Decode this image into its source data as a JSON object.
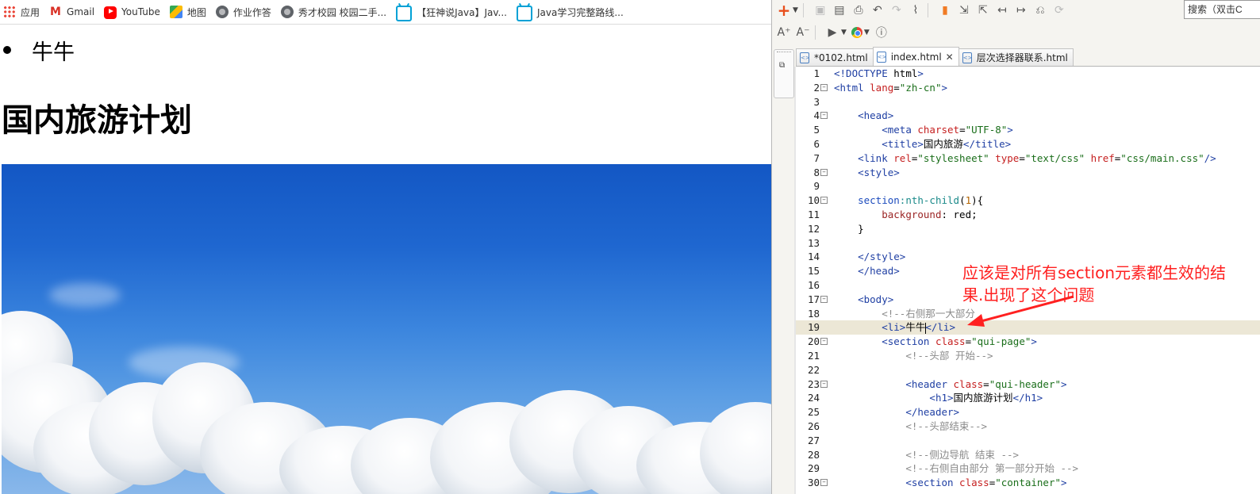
{
  "browser": {
    "bookmarks": [
      {
        "icon": "apps-icon",
        "label": "应用"
      },
      {
        "icon": "gmail-icon",
        "label": "Gmail"
      },
      {
        "icon": "youtube-icon",
        "label": "YouTube"
      },
      {
        "icon": "maps-icon",
        "label": "地图"
      },
      {
        "icon": "globe-icon",
        "label": "作业作答"
      },
      {
        "icon": "globe-icon",
        "label": "秀才校园 校园二手..."
      },
      {
        "icon": "bilibili-icon",
        "label": "【狂神说Java】Jav..."
      },
      {
        "icon": "bilibili-icon",
        "label": "Java学习完整路线..."
      }
    ],
    "page": {
      "list_item": "牛牛",
      "heading": "国内旅游计划",
      "hero_image": "sky-with-clouds"
    }
  },
  "editor": {
    "search_placeholder": "搜索（双击C",
    "tabs": [
      {
        "label": "*0102.html",
        "active": false,
        "closable": false
      },
      {
        "label": "index.html",
        "active": true,
        "closable": true
      },
      {
        "label": "层次选择器联系.html",
        "active": false,
        "closable": false
      }
    ],
    "current_line": 19,
    "lines": [
      {
        "n": "1",
        "fold": false,
        "tokens": [
          [
            "tg",
            "<!DOCTYPE "
          ],
          [
            "tx2",
            "html"
          ],
          [
            "tg",
            ">"
          ]
        ]
      },
      {
        "n": "2",
        "fold": true,
        "tokens": [
          [
            "tg",
            "<html "
          ],
          [
            "at",
            "lang"
          ],
          [
            "tx2",
            "="
          ],
          [
            "st",
            "\"zh-cn\""
          ],
          [
            "tg",
            ">"
          ]
        ]
      },
      {
        "n": "3",
        "fold": false,
        "tokens": []
      },
      {
        "n": "4",
        "fold": true,
        "tokens": [
          [
            "tx2",
            "    "
          ],
          [
            "tg",
            "<head>"
          ]
        ]
      },
      {
        "n": "5",
        "fold": false,
        "tokens": [
          [
            "tx2",
            "        "
          ],
          [
            "tg",
            "<meta "
          ],
          [
            "at",
            "charset"
          ],
          [
            "tx2",
            "="
          ],
          [
            "st",
            "\"UTF-8\""
          ],
          [
            "tg",
            ">"
          ]
        ]
      },
      {
        "n": "6",
        "fold": false,
        "tokens": [
          [
            "tx2",
            "        "
          ],
          [
            "tg",
            "<title>"
          ],
          [
            "tx2",
            "国内旅游"
          ],
          [
            "tg",
            "</title>"
          ]
        ]
      },
      {
        "n": "7",
        "fold": false,
        "tokens": [
          [
            "tx2",
            "    "
          ],
          [
            "tg",
            "<link "
          ],
          [
            "at",
            "rel"
          ],
          [
            "tx2",
            "="
          ],
          [
            "st",
            "\"stylesheet\" "
          ],
          [
            "at",
            "type"
          ],
          [
            "tx2",
            "="
          ],
          [
            "st",
            "\"text/css\" "
          ],
          [
            "at",
            "href"
          ],
          [
            "tx2",
            "="
          ],
          [
            "st",
            "\"css/main.css\""
          ],
          [
            "tg",
            "/>"
          ]
        ]
      },
      {
        "n": "8",
        "fold": true,
        "tokens": [
          [
            "tx2",
            "    "
          ],
          [
            "tg",
            "<style>"
          ]
        ]
      },
      {
        "n": "9",
        "fold": false,
        "tokens": []
      },
      {
        "n": "10",
        "fold": true,
        "tokens": [
          [
            "tx2",
            "    "
          ],
          [
            "sel",
            "section"
          ],
          [
            "ps",
            ":nth-child"
          ],
          [
            "tx2",
            "("
          ],
          [
            "nm",
            "1"
          ],
          [
            "tx2",
            "){"
          ]
        ]
      },
      {
        "n": "11",
        "fold": false,
        "tokens": [
          [
            "tx2",
            "        "
          ],
          [
            "pr",
            "background"
          ],
          [
            "tx2",
            ": red;"
          ]
        ]
      },
      {
        "n": "12",
        "fold": false,
        "tokens": [
          [
            "tx2",
            "    }"
          ]
        ]
      },
      {
        "n": "13",
        "fold": false,
        "tokens": []
      },
      {
        "n": "14",
        "fold": false,
        "tokens": [
          [
            "tx2",
            "    "
          ],
          [
            "tg",
            "</style>"
          ]
        ]
      },
      {
        "n": "15",
        "fold": false,
        "tokens": [
          [
            "tx2",
            "    "
          ],
          [
            "tg",
            "</head>"
          ]
        ]
      },
      {
        "n": "16",
        "fold": false,
        "tokens": []
      },
      {
        "n": "17",
        "fold": true,
        "tokens": [
          [
            "tx2",
            "    "
          ],
          [
            "tg",
            "<body>"
          ]
        ]
      },
      {
        "n": "18",
        "fold": false,
        "tokens": [
          [
            "tx2",
            "        "
          ],
          [
            "cm",
            "<!--右侧那一大部分"
          ]
        ]
      },
      {
        "n": "19",
        "fold": false,
        "tokens": [
          [
            "tx2",
            "        "
          ],
          [
            "tg",
            "<li>"
          ],
          [
            "tx2",
            "牛牛"
          ],
          [
            "cursor",
            ""
          ],
          [
            "tg",
            "</li>"
          ]
        ]
      },
      {
        "n": "20",
        "fold": true,
        "tokens": [
          [
            "tx2",
            "        "
          ],
          [
            "tg",
            "<section "
          ],
          [
            "at",
            "class"
          ],
          [
            "tx2",
            "="
          ],
          [
            "st",
            "\"qui-page\""
          ],
          [
            "tg",
            ">"
          ]
        ]
      },
      {
        "n": "21",
        "fold": false,
        "tokens": [
          [
            "tx2",
            "            "
          ],
          [
            "cm",
            "<!--头部 开始-->"
          ]
        ]
      },
      {
        "n": "22",
        "fold": false,
        "tokens": []
      },
      {
        "n": "23",
        "fold": true,
        "tokens": [
          [
            "tx2",
            "            "
          ],
          [
            "tg",
            "<header "
          ],
          [
            "at",
            "class"
          ],
          [
            "tx2",
            "="
          ],
          [
            "st",
            "\"qui-header\""
          ],
          [
            "tg",
            ">"
          ]
        ]
      },
      {
        "n": "24",
        "fold": false,
        "tokens": [
          [
            "tx2",
            "                "
          ],
          [
            "tg",
            "<h1>"
          ],
          [
            "tx2",
            "国内旅游计划"
          ],
          [
            "tg",
            "</h1>"
          ]
        ]
      },
      {
        "n": "25",
        "fold": false,
        "tokens": [
          [
            "tx2",
            "            "
          ],
          [
            "tg",
            "</header>"
          ]
        ]
      },
      {
        "n": "26",
        "fold": false,
        "tokens": [
          [
            "tx2",
            "            "
          ],
          [
            "cm",
            "<!--头部结束-->"
          ]
        ]
      },
      {
        "n": "27",
        "fold": false,
        "tokens": []
      },
      {
        "n": "28",
        "fold": false,
        "tokens": [
          [
            "tx2",
            "            "
          ],
          [
            "cm",
            "<!--侧边导航 结束 -->"
          ]
        ]
      },
      {
        "n": "29",
        "fold": false,
        "tokens": [
          [
            "tx2",
            "            "
          ],
          [
            "cm",
            "<!--右侧自由部分 第一部分开始 -->"
          ]
        ]
      },
      {
        "n": "30",
        "fold": true,
        "tokens": [
          [
            "tx2",
            "            "
          ],
          [
            "tg",
            "<section "
          ],
          [
            "at",
            "class"
          ],
          [
            "tx2",
            "="
          ],
          [
            "st",
            "\"container\""
          ],
          [
            "tg",
            ">"
          ]
        ]
      }
    ]
  },
  "annotation": {
    "text_line1": "应该是对所有section元素都生效的结",
    "text_line2": "果.出现了这个问题",
    "color": "#ff2020"
  }
}
